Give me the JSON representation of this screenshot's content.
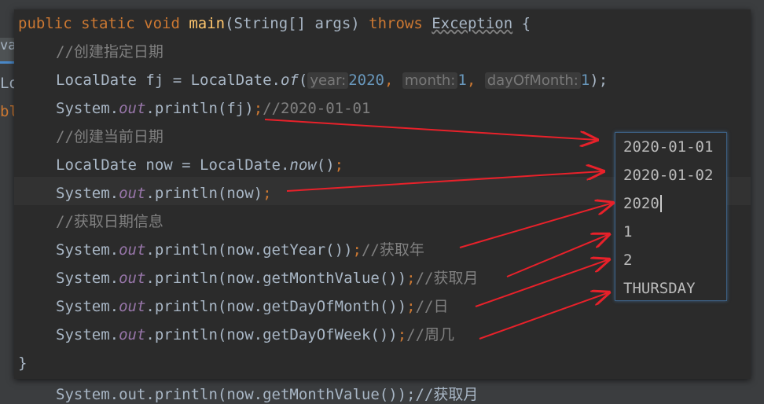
{
  "background": {
    "tab": "va",
    "lines": [
      "Lo",
      "bl",
      "System.out.println(now.getMonthValue());//获取月"
    ]
  },
  "code": {
    "l0": {
      "a": "public static void ",
      "b": "main",
      "c": "(String[] args) ",
      "d": "throws ",
      "e": "Exception",
      "f": " {"
    },
    "l1": "//创建指定日期",
    "l2": {
      "a": "LocalDate fj = LocalDate.",
      "b": "of",
      "c": "(",
      "h1": "year:",
      "v1": "2020",
      "d": ", ",
      "h2": "month:",
      "v2": "1",
      "h3": "dayOfMonth:",
      "v3": "1",
      "e": ");"
    },
    "l3": {
      "a": "System.",
      "b": "out",
      "c": ".println(fj)",
      "d": ";",
      "e": "//2020-01-01"
    },
    "l4": "//创建当前日期",
    "l5": {
      "a": "LocalDate now = LocalDate.",
      "b": "now",
      "c": "()",
      "d": ";"
    },
    "l6": {
      "a": "System.",
      "b": "out",
      "c": ".println(now)",
      "d": ";"
    },
    "l7": "//获取日期信息",
    "l8": {
      "a": "System.",
      "b": "out",
      "c": ".println(now.getYear())",
      "d": ";",
      "e": "//获取年"
    },
    "l9": {
      "a": "System.",
      "b": "out",
      "c": ".println(now.getMonthValue())",
      "d": ";",
      "e": "//获取月"
    },
    "l10": {
      "a": "System.",
      "b": "out",
      "c": ".println(now.getDayOfMonth())",
      "d": ";",
      "e": "//日"
    },
    "l11": {
      "a": "System.",
      "b": "out",
      "c": ".println(now.getDayOfWeek())",
      "d": ";",
      "e": "//周几"
    },
    "l12": "}"
  },
  "output": [
    "2020-01-01",
    "2020-01-02",
    "2020",
    "1",
    "2",
    "THURSDAY"
  ],
  "colors": {
    "arrow": "#e8212a"
  }
}
